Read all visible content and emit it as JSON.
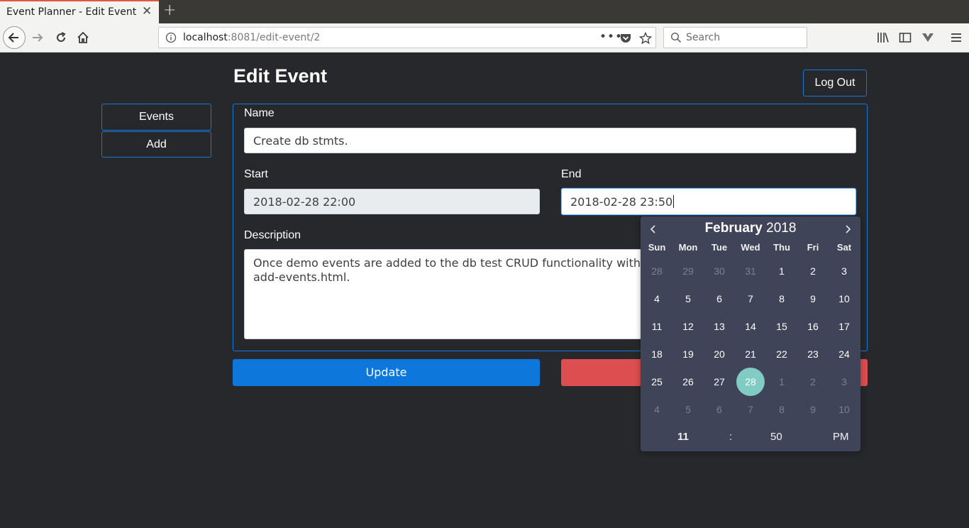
{
  "browser": {
    "tab_title": "Event Planner - Edit Event",
    "url_host": "localhost",
    "url_rest": ":8081/edit-event/2",
    "search_placeholder": "Search"
  },
  "page": {
    "title": "Edit Event",
    "logout_label": "Log Out",
    "sidebar": {
      "events_label": "Events",
      "add_label": "Add"
    },
    "form": {
      "name_label": "Name",
      "name_value": "Create db stmts.",
      "start_label": "Start",
      "start_value": "2018-02-28 22:00",
      "end_label": "End",
      "end_value": "2018-02-28 23:50",
      "description_label": "Description",
      "description_line1": "Once demo events are added to the db test CRUD functionality with",
      "description_line2": "add-events.html."
    },
    "update_label": "Update"
  },
  "calendar": {
    "month": "February",
    "year": "2018",
    "weekdays": [
      "Sun",
      "Mon",
      "Tue",
      "Wed",
      "Thu",
      "Fri",
      "Sat"
    ],
    "weeks": [
      [
        "28",
        "29",
        "30",
        "31",
        "1",
        "2",
        "3"
      ],
      [
        "4",
        "5",
        "6",
        "7",
        "8",
        "9",
        "10"
      ],
      [
        "11",
        "12",
        "13",
        "14",
        "15",
        "16",
        "17"
      ],
      [
        "18",
        "19",
        "20",
        "21",
        "22",
        "23",
        "24"
      ],
      [
        "25",
        "26",
        "27",
        "28",
        "1",
        "2",
        "3"
      ],
      [
        "4",
        "5",
        "6",
        "7",
        "8",
        "9",
        "10"
      ]
    ],
    "selected_day": "28",
    "time": {
      "hour": "11",
      "separator": ":",
      "minute": "50",
      "ampm": "PM"
    },
    "colors": {
      "background": "#3f4458",
      "selected": "#80cbc4"
    }
  },
  "colors": {
    "primary": "#0d77dc",
    "danger": "#dc4e50",
    "outline": "#1778d4",
    "page_bg": "#26282b"
  }
}
